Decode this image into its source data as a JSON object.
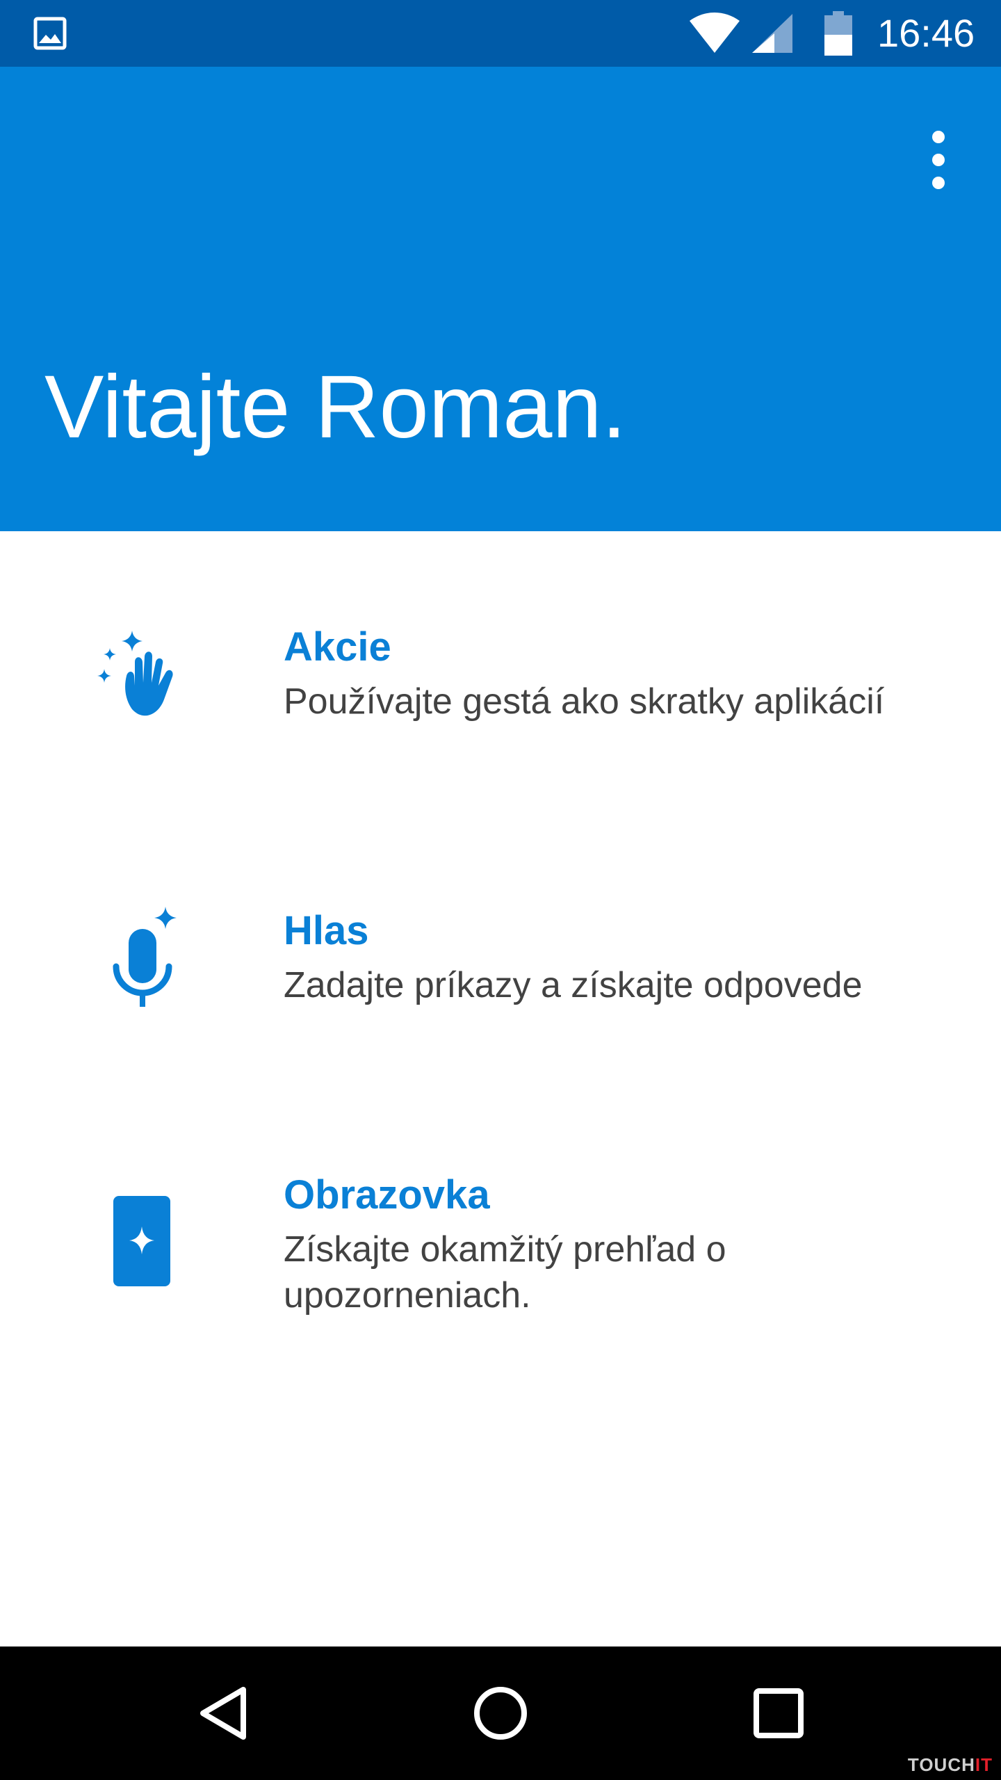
{
  "status_bar": {
    "time": "16:46",
    "icons": [
      "image-icon",
      "wifi-icon",
      "cell-signal-icon",
      "battery-icon"
    ],
    "color": "#005ba8"
  },
  "header": {
    "welcome": "Vitajte Roman.",
    "menu_icon": "more-vert-icon",
    "color": "#0382d8"
  },
  "features": [
    {
      "title": "Akcie",
      "description": "Používajte gestá ako skratky aplikácií",
      "icon": "wave-hand-sparkle-icon"
    },
    {
      "title": "Hlas",
      "description": "Zadajte príkazy a získajte odpovede",
      "icon": "microphone-sparkle-icon"
    },
    {
      "title": "Obrazovka",
      "description": "Získajte okamžitý prehľad o upozorneniach.",
      "icon": "phone-sparkle-icon"
    }
  ],
  "nav_bar": {
    "icons": [
      "back-icon",
      "home-icon",
      "recents-icon"
    ]
  },
  "watermark": {
    "text_main": "TOUCH",
    "text_accent": "IT"
  },
  "colors": {
    "accent": "#0a80d6",
    "text": "#424242"
  }
}
